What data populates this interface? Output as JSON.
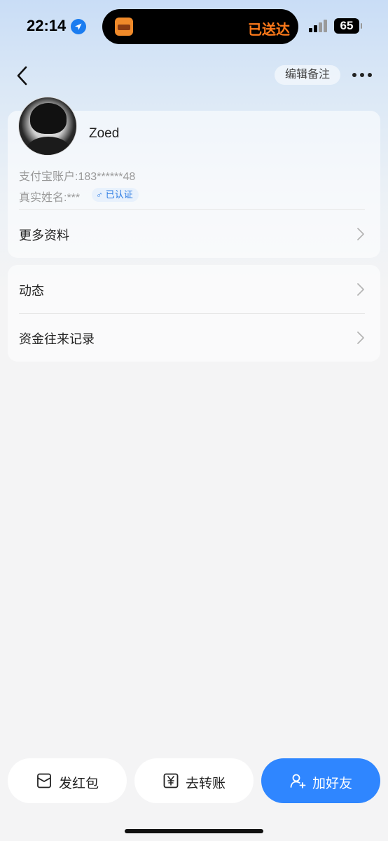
{
  "status_bar": {
    "time": "22:14",
    "island_text": "已送达",
    "battery": "65",
    "icons": [
      "location-icon",
      "app-icon",
      "signal-icon",
      "battery-icon"
    ]
  },
  "header": {
    "edit_note_label": "编辑备注",
    "icons": [
      "back-icon",
      "more-icon"
    ]
  },
  "profile": {
    "name": "Zoed",
    "account_label": "支付宝账户:183******48",
    "realname_label": "真实姓名:***",
    "verified_label": "已认证",
    "gender_symbol": "♂",
    "more_info_label": "更多资料"
  },
  "links": {
    "items": [
      {
        "label": "动态"
      },
      {
        "label": "资金往来记录"
      }
    ]
  },
  "bottom_actions": {
    "red_packet_label": "发红包",
    "transfer_label": "去转账",
    "add_friend_label": "加好友"
  },
  "colors": {
    "accent": "#2f86ff",
    "verified_text": "#2b7be3",
    "island_text": "#ff7a1a"
  }
}
